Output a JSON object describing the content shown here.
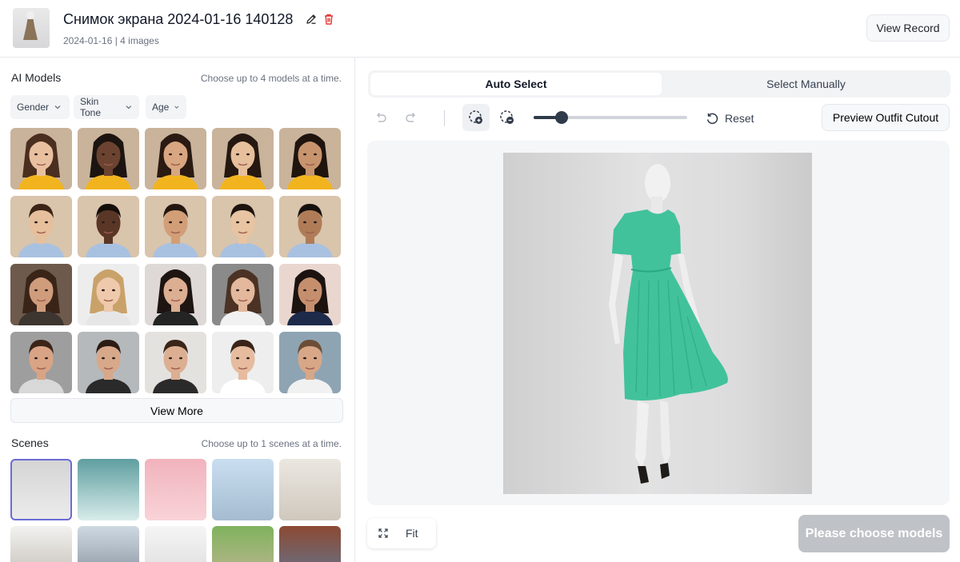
{
  "header": {
    "title": "Снимок экрана 2024-01-16 140128",
    "subtitle": "2024-01-16 | 4 images",
    "view_record": "View Record",
    "icons": [
      "dress-thumbnail",
      "pencil-icon",
      "trash-icon"
    ]
  },
  "models_section": {
    "title": "AI Models",
    "hint": "Choose up to 4 models at a time.",
    "filters": [
      {
        "label": "Gender"
      },
      {
        "label": "Skin Tone"
      },
      {
        "label": "Age"
      }
    ],
    "view_more": "View More",
    "models": [
      {
        "row": 0,
        "bg": "#c9b39b",
        "skin": "#e8c0a0",
        "hair": "#4a2e1f",
        "top": "#f2b41e"
      },
      {
        "row": 0,
        "bg": "#c9b39b",
        "skin": "#6b4330",
        "hair": "#1c1410",
        "top": "#f2b41e"
      },
      {
        "row": 0,
        "bg": "#c9b39b",
        "skin": "#d8a680",
        "hair": "#2a1a12",
        "top": "#f2b41e"
      },
      {
        "row": 0,
        "bg": "#c9b39b",
        "skin": "#e6bf9c",
        "hair": "#241810",
        "top": "#f2b41e"
      },
      {
        "row": 0,
        "bg": "#c9b39b",
        "skin": "#c7946e",
        "hair": "#1f140e",
        "top": "#f2b41e"
      },
      {
        "row": 1,
        "bg": "#d9c4ac",
        "skin": "#e6bf9c",
        "hair": "#3b2417",
        "top": "#a9c1e0"
      },
      {
        "row": 1,
        "bg": "#d9c4ac",
        "skin": "#5a3626",
        "hair": "#140e0b",
        "top": "#a9c1e0"
      },
      {
        "row": 1,
        "bg": "#d9c4ac",
        "skin": "#d29e78",
        "hair": "#24160f",
        "top": "#a9c1e0"
      },
      {
        "row": 1,
        "bg": "#d9c4ac",
        "skin": "#e8c4a2",
        "hair": "#1d140e",
        "top": "#a9c1e0"
      },
      {
        "row": 1,
        "bg": "#d9c4ac",
        "skin": "#b07c58",
        "hair": "#15100c",
        "top": "#a9c1e0"
      },
      {
        "row": 2,
        "bg": "#6d5a4c",
        "skin": "#cf9c7c",
        "hair": "#3a2418",
        "top": "#3d3530"
      },
      {
        "row": 2,
        "bg": "#ededed",
        "skin": "#efc9ac",
        "hair": "#c9a26a",
        "top": "#e6e6e6"
      },
      {
        "row": 2,
        "bg": "#ded9d6",
        "skin": "#dcae92",
        "hair": "#1e1512",
        "top": "#242424"
      },
      {
        "row": 2,
        "bg": "#8a8a8a",
        "skin": "#e3b89c",
        "hair": "#4b3224",
        "top": "#f1f1f1"
      },
      {
        "row": 2,
        "bg": "#e9d7cf",
        "skin": "#c58f6e",
        "hair": "#1c1310",
        "top": "#1d2a4a"
      },
      {
        "row": 3,
        "bg": "#9e9e9e",
        "skin": "#d9a485",
        "hair": "#3b2418",
        "top": "#d8d8d8"
      },
      {
        "row": 3,
        "bg": "#b5b9bc",
        "skin": "#d7a88a",
        "hair": "#2b1c14",
        "top": "#2a2a2a"
      },
      {
        "row": 3,
        "bg": "#e4e2df",
        "skin": "#dcae92",
        "hair": "#3b2519",
        "top": "#2a2a2a"
      },
      {
        "row": 3,
        "bg": "#eeeeee",
        "skin": "#e6bb9e",
        "hair": "#3a2419",
        "top": "#ffffff"
      },
      {
        "row": 3,
        "bg": "#8ea4b3",
        "skin": "#d7a788",
        "hair": "#6b4d36",
        "top": "#f1f1f1"
      }
    ]
  },
  "scenes_section": {
    "title": "Scenes",
    "hint": "Choose up to 1 scenes at a time.",
    "scenes": [
      {
        "bg1": "#d4d4d4",
        "bg2": "#ececec",
        "selected": true
      },
      {
        "bg1": "#5f9ea0",
        "bg2": "#d7ecea",
        "selected": false
      },
      {
        "bg1": "#f1b3bd",
        "bg2": "#f8d3d8",
        "selected": false
      },
      {
        "bg1": "#c9dff0",
        "bg2": "#a5bcd0",
        "selected": false
      },
      {
        "bg1": "#ebe7e1",
        "bg2": "#cfc8bd",
        "selected": false
      },
      {
        "bg1": "#f2f2f0",
        "bg2": "#bdb6ad",
        "selected": false
      },
      {
        "bg1": "#cfd9e2",
        "bg2": "#7d8a96",
        "selected": false
      },
      {
        "bg1": "#f5f5f5",
        "bg2": "#d9d9d9",
        "selected": false
      },
      {
        "bg1": "#7fb35d",
        "bg2": "#c9b59a",
        "selected": false
      },
      {
        "bg1": "#8c4a33",
        "bg2": "#5d7a9c",
        "selected": false
      }
    ]
  },
  "editor": {
    "tabs": [
      {
        "label": "Auto Select",
        "active": true
      },
      {
        "label": "Select Manually",
        "active": false
      }
    ],
    "brush_size": 0.18,
    "reset_label": "Reset",
    "preview_label": "Preview Outfit Cutout",
    "fit_label": "Fit",
    "choose_label": "Please choose models",
    "mask_color": "#33bf95"
  }
}
